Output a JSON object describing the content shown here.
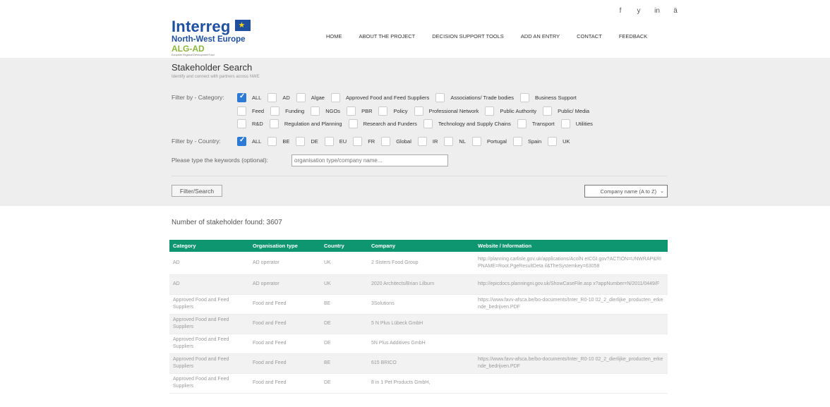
{
  "social": [
    "f",
    "y",
    "in",
    "ä"
  ],
  "logo": {
    "title": "Interreg",
    "region": "North-West Europe",
    "project": "ALG-AD",
    "tagline": "European Regional Development Fund"
  },
  "nav": [
    "HOME",
    "ABOUT THE PROJECT",
    "DECISION SUPPORT TOOLS",
    "ADD AN ENTRY",
    "CONTACT",
    "FEEDBACK"
  ],
  "search": {
    "title": "Stakeholder Search",
    "subtitle": "Identify and connect with partners across NWE",
    "category_label": "Filter by - Category:",
    "country_label": "Filter by - Country:",
    "keyword_label": "Please type the keywords (optional):",
    "keyword_placeholder": "organisation type/company name...",
    "filter_button": "Filter/Search",
    "sort_value": "Company name (A to Z)"
  },
  "categories": [
    [
      "ALL",
      "AD",
      "Algae",
      "Approved Food and Feed Suppliers",
      "Associations/ Trade bodies",
      "Business Support"
    ],
    [
      "Feed",
      "Funding",
      "NGOs",
      "PBR",
      "Policy",
      "Professional Network",
      "Public Authority",
      "Public/ Media"
    ],
    [
      "R&D",
      "Regulation and Planning",
      "Research and Funders",
      "Technology and Supply Chains",
      "Transport",
      "Utilities"
    ]
  ],
  "countries": [
    "ALL",
    "BE",
    "DE",
    "EU",
    "FR",
    "Global",
    "IR",
    "NL",
    "Portugal",
    "Spain",
    "UK"
  ],
  "results": {
    "count_text": "Number of stakeholder found: 3607",
    "columns": [
      "Category",
      "Organisation type",
      "Country",
      "Company",
      "Website / Information"
    ],
    "rows": [
      [
        "AD",
        "AD operator",
        "UK",
        "2 Sisters Food Group",
        "http://planning.carlisle.gov.uk/applications/AcolN eICGI.gov?ACTION=UNWRAP&RIPNAME=Root.PgeResultDeta il&TheSystemkey=63058"
      ],
      [
        "AD",
        "AD operator",
        "UK",
        "2020 Architects/Brian Lilburn",
        "http://epicdocs.planningni.gov.uk/ShowCaseFile.asp x?appNumber=N/2011/0449/F"
      ],
      [
        "Approved Food and Feed Suppliers",
        "Food and Feed",
        "BE",
        "3Solutions",
        "https://www.favv-afsca.be/bo-documents/Inter_R0-10 02_2_dierlijke_producten_erkende_bedrijven.PDF"
      ],
      [
        "Approved Food and Feed Suppliers",
        "Food and Feed",
        "DE",
        "5 N Plus Lübeck GmbH",
        ""
      ],
      [
        "Approved Food and Feed Suppliers",
        "Food and Feed",
        "DE",
        "5N Plus Additives GmbH",
        ""
      ],
      [
        "Approved Food and Feed Suppliers",
        "Food and Feed",
        "BE",
        "615 BRICO",
        "https://www.favv-afsca.be/bo-documents/Inter_R0-10 02_2_dierlijke_producten_erkende_bedrijven.PDF"
      ],
      [
        "Approved Food and Feed Suppliers",
        "Food and Feed",
        "DE",
        "8 in 1 Pet Products GmbH,",
        ""
      ]
    ]
  }
}
